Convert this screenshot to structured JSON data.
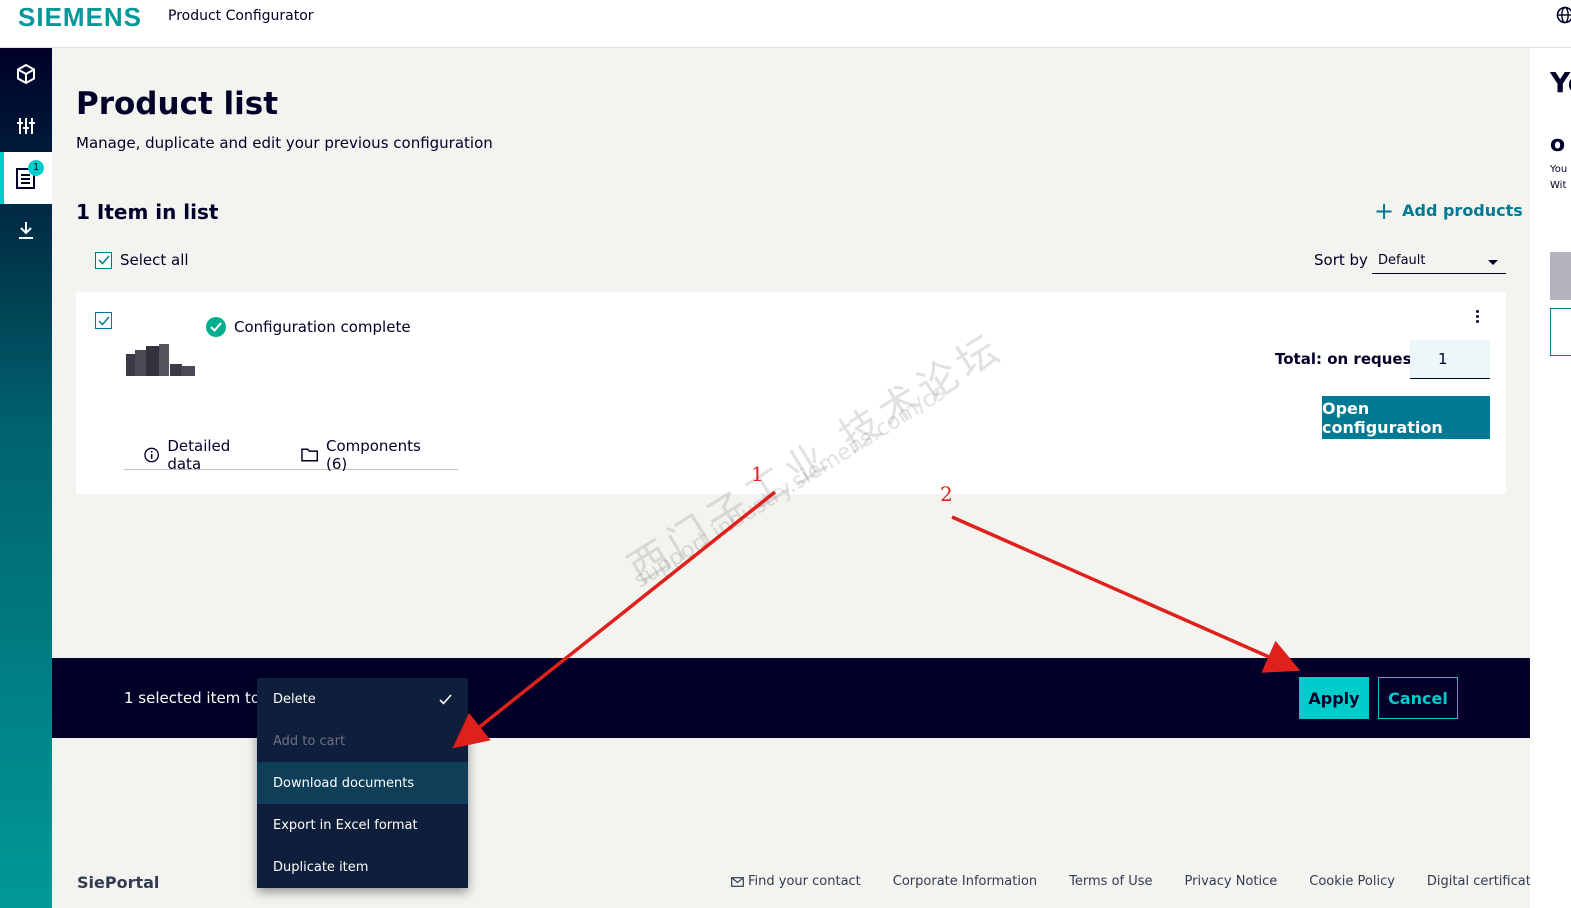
{
  "header": {
    "brand": "SIEMENS",
    "app_title": "Product Configurator"
  },
  "sidebar": {
    "items": [
      {
        "icon": "cube-icon"
      },
      {
        "icon": "sliders-icon"
      },
      {
        "icon": "product-list-icon",
        "badge": "1",
        "active": true
      },
      {
        "icon": "download-icon"
      }
    ]
  },
  "main": {
    "title": "Product list",
    "subtitle": "Manage, duplicate and edit your previous configuration",
    "count_title": "1 Item in list",
    "add_products": "Add products",
    "select_all": "Select all",
    "sort_label": "Sort by",
    "sort_value": "Default"
  },
  "card": {
    "status": "Configuration complete",
    "total_label": "Total:",
    "total_value": "on request",
    "quantity": "1",
    "open_button": "Open configuration",
    "tabs": [
      "Detailed data",
      "Components (6)"
    ]
  },
  "actionbar": {
    "label": "1  selected item to",
    "apply": "Apply",
    "cancel": "Cancel"
  },
  "menu": {
    "items": [
      {
        "label": "Delete",
        "checked": true
      },
      {
        "label": "Add to cart",
        "disabled": true
      },
      {
        "label": "Download documents",
        "highlighted": true
      },
      {
        "label": "Export in Excel format"
      },
      {
        "label": "Duplicate item"
      }
    ]
  },
  "footer": {
    "brand": "SiePortal",
    "links": [
      "Find your contact",
      "Corporate Information",
      "Terms of Use",
      "Privacy Notice",
      "Cookie Policy",
      "Digital certificate"
    ]
  },
  "right_panel": {
    "big": "Yo",
    "o": "o",
    "line1": "You",
    "line2": "Wit"
  },
  "watermark": {
    "line1": "西门子工业 技术论坛",
    "line2": "support.industry.siemens.com/cs"
  },
  "annotations": [
    "1",
    "2"
  ],
  "colors": {
    "brand": "#009999",
    "petrol": "#007993",
    "accent": "#00cccc",
    "dark": "#000028",
    "arrow": "#e0201a"
  }
}
